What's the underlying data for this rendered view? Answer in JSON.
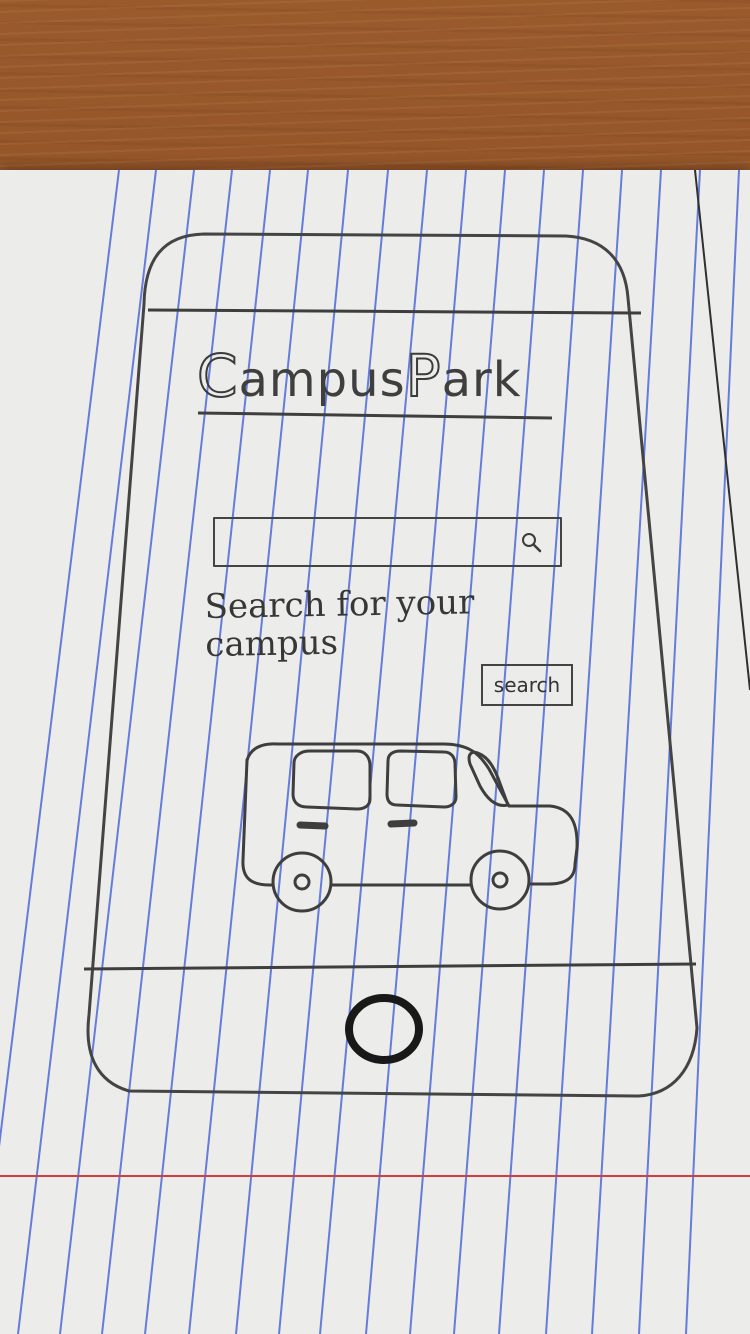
{
  "app": {
    "title": "CampusPark",
    "brand_parts": [
      "C",
      "ampus",
      "P",
      "ark"
    ]
  },
  "search": {
    "value": "",
    "placeholder": "",
    "helper_text": "Search for your\n        campus",
    "button_label": "search"
  },
  "icons": {
    "search": "search-icon",
    "car": "car-icon",
    "home": "home-button-icon"
  },
  "colors": {
    "paper": "#ececea",
    "ink": "#3d3d3d",
    "rule_blue": "#4b68d9",
    "margin_red": "#d43c3c"
  }
}
